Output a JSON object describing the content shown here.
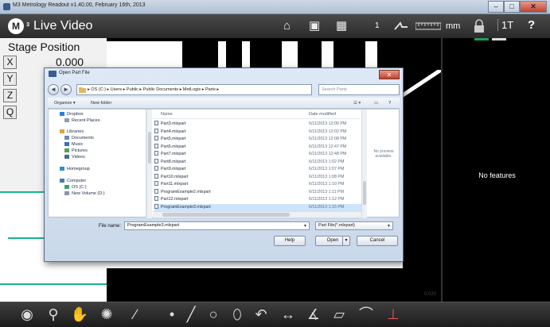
{
  "window": {
    "title": "M3 Metrology Readout  v1.40.00, February 16th, 2013",
    "minimize": "–",
    "maximize": "□",
    "close": "✕"
  },
  "toolbar": {
    "logo": "M",
    "logo_sup": "3",
    "view_title": "Live Video",
    "home_icon": "⌂",
    "video_icon": "▣",
    "grid_icon": "▦",
    "count": "1",
    "units": "mm",
    "lock_icon": "🔒",
    "one_t": "1T",
    "help": "?"
  },
  "stage": {
    "title": "Stage Position",
    "axes": [
      "X",
      "Y",
      "Z",
      "Q"
    ],
    "x_value": "0.000"
  },
  "features": {
    "empty_text": "No features"
  },
  "video": {
    "readout": "0.020"
  },
  "dialog": {
    "title": "Open Part File",
    "close": "✕",
    "back": "◄",
    "forward": "►",
    "breadcrumb": "▸ OS (C:) ▸ Users ▸ Public ▸ Public Documents ▸ MetLogix ▸ Parts ▸",
    "search_placeholder": "Search Parts",
    "organize": "Organize ▾",
    "new_folder": "New folder",
    "nav_items": [
      {
        "label": "Dropbox",
        "icon": "dropbox-icon",
        "color": "#2b7de0"
      },
      {
        "label": "Recent Places",
        "icon": "recent-places-icon",
        "color": "#8c9cb5"
      },
      {
        "label": "Libraries",
        "icon": "libraries-icon",
        "color": "#d9a53c"
      },
      {
        "label": "Documents",
        "icon": "documents-icon",
        "color": "#6b8ab8"
      },
      {
        "label": "Music",
        "icon": "music-icon",
        "color": "#3b6fb6"
      },
      {
        "label": "Pictures",
        "icon": "pictures-icon",
        "color": "#5aa05a"
      },
      {
        "label": "Videos",
        "icon": "videos-icon",
        "color": "#4a6a8a"
      },
      {
        "label": "Homegroup",
        "icon": "homegroup-icon",
        "color": "#2f8fd0"
      },
      {
        "label": "Computer",
        "icon": "computer-icon",
        "color": "#4a78b0"
      },
      {
        "label": "OS (C:)",
        "icon": "drive-icon",
        "color": "#3f9f6f"
      },
      {
        "label": "New Volume (D:)",
        "icon": "drive-icon",
        "color": "#8a95a5"
      }
    ],
    "col_name": "Name",
    "col_date": "Date modified",
    "files": [
      {
        "name": "Part3.mlxpart",
        "date": "6/11/2013 12:00 PM"
      },
      {
        "name": "Part4.mlxpart",
        "date": "6/11/2013 12:02 PM"
      },
      {
        "name": "Part5.mlxpart",
        "date": "6/11/2013 12:08 PM"
      },
      {
        "name": "Part6.mlxpart",
        "date": "6/11/2013 12:47 PM"
      },
      {
        "name": "Part7.mlxpart",
        "date": "6/11/2013 12:48 PM"
      },
      {
        "name": "Part8.mlxpart",
        "date": "6/11/2013 1:02 PM"
      },
      {
        "name": "Part9.mlxpart",
        "date": "6/11/2013 1:07 PM"
      },
      {
        "name": "Part10.mlxpart",
        "date": "6/11/2013 1:08 PM"
      },
      {
        "name": "Part11.mlxpart",
        "date": "6/11/2013 1:10 PM"
      },
      {
        "name": "ProgramExample2.mlxpart",
        "date": "6/11/2013 1:11 PM"
      },
      {
        "name": "Part12.mlxpart",
        "date": "6/11/2013 1:12 PM"
      },
      {
        "name": "ProgramExample3.mlxpart",
        "date": "6/11/2013 1:15 PM"
      }
    ],
    "selected_index": 11,
    "preview_text": "No preview available.",
    "filename_label": "File name:",
    "filename_value": "ProgramExample3.mlxpart",
    "filter_value": "Part File(*.mlxpart)",
    "help_button": "Help",
    "open_button": "Open",
    "cancel_button": "Cancel"
  },
  "bottom_tools": [
    {
      "glyph": "◉",
      "name": "probe-icon"
    },
    {
      "glyph": "⚲",
      "name": "zoom-icon"
    },
    {
      "glyph": "✋",
      "name": "hand-icon"
    },
    {
      "glyph": "✺",
      "name": "light-icon"
    },
    {
      "glyph": "∕",
      "name": "pen-icon"
    },
    {
      "glyph": "•",
      "name": "point-icon"
    },
    {
      "glyph": "╱",
      "name": "line-icon"
    },
    {
      "glyph": "○",
      "name": "circle-icon"
    },
    {
      "glyph": "⬯",
      "name": "slot-icon"
    },
    {
      "glyph": "↶",
      "name": "arc-icon"
    },
    {
      "glyph": "↔",
      "name": "distance-icon"
    },
    {
      "glyph": "∡",
      "name": "angle-icon"
    },
    {
      "glyph": "▱",
      "name": "rectangle-icon"
    },
    {
      "glyph": "⌒",
      "name": "curve-icon"
    },
    {
      "glyph": "⊥",
      "name": "datum-icon"
    }
  ]
}
